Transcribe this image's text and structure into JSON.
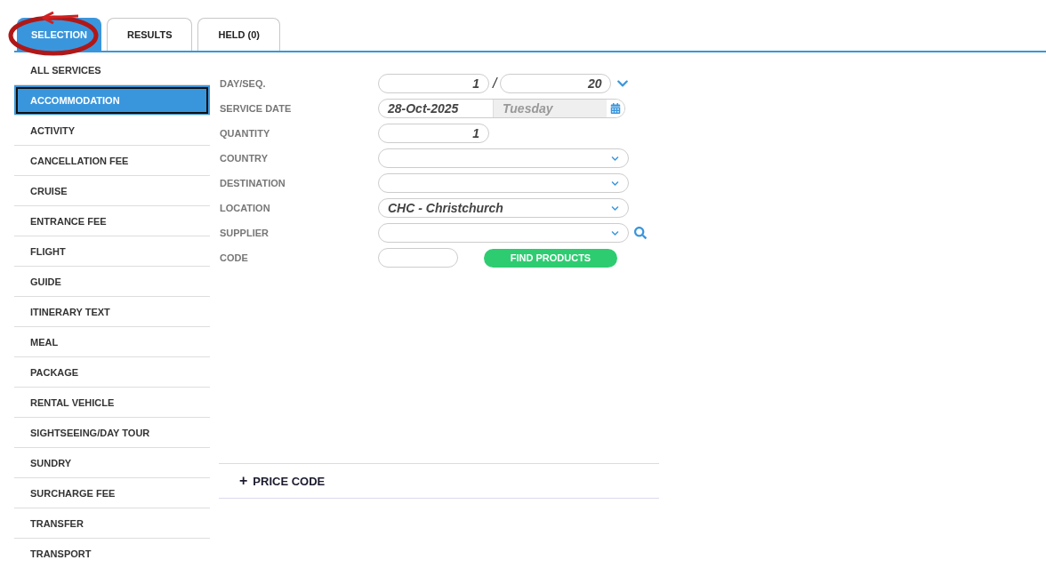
{
  "tabs": [
    {
      "label": "SELECTION",
      "selected": true
    },
    {
      "label": "RESULTS",
      "selected": false
    },
    {
      "label": "HELD (0)",
      "selected": false
    }
  ],
  "service_types": [
    {
      "label": "ALL SERVICES",
      "selected": false
    },
    {
      "label": "ACCOMMODATION",
      "selected": true
    },
    {
      "label": "ACTIVITY",
      "selected": false
    },
    {
      "label": "CANCELLATION FEE",
      "selected": false
    },
    {
      "label": "CRUISE",
      "selected": false
    },
    {
      "label": "ENTRANCE FEE",
      "selected": false
    },
    {
      "label": "FLIGHT",
      "selected": false
    },
    {
      "label": "GUIDE",
      "selected": false
    },
    {
      "label": "ITINERARY TEXT",
      "selected": false
    },
    {
      "label": "MEAL",
      "selected": false
    },
    {
      "label": "PACKAGE",
      "selected": false
    },
    {
      "label": "RENTAL VEHICLE",
      "selected": false
    },
    {
      "label": "SIGHTSEEING/DAY TOUR",
      "selected": false
    },
    {
      "label": "SUNDRY",
      "selected": false
    },
    {
      "label": "SURCHARGE FEE",
      "selected": false
    },
    {
      "label": "TRANSFER",
      "selected": false
    },
    {
      "label": "TRANSPORT",
      "selected": false
    }
  ],
  "form": [
    {
      "kind": "pair",
      "label": "DAY/SEQ.",
      "value": "1",
      "separator": "/",
      "value2": "20"
    },
    {
      "kind": "date",
      "label": "SERVICE DATE",
      "value": "28-Oct-2025",
      "weekday": "Tuesday"
    },
    {
      "kind": "number",
      "label": "QUANTITY",
      "value": "1"
    },
    {
      "kind": "select",
      "label": "COUNTRY"
    },
    {
      "kind": "select",
      "label": "DESTINATION"
    },
    {
      "kind": "select",
      "label": "LOCATION",
      "value": "CHC - Christchurch"
    },
    {
      "kind": "search",
      "label": "SUPPLIER"
    },
    {
      "kind": "code",
      "label": "CODE",
      "button": "FIND PRODUCTS"
    }
  ],
  "price_code": {
    "icon": "+",
    "label": "PRICE CODE"
  }
}
